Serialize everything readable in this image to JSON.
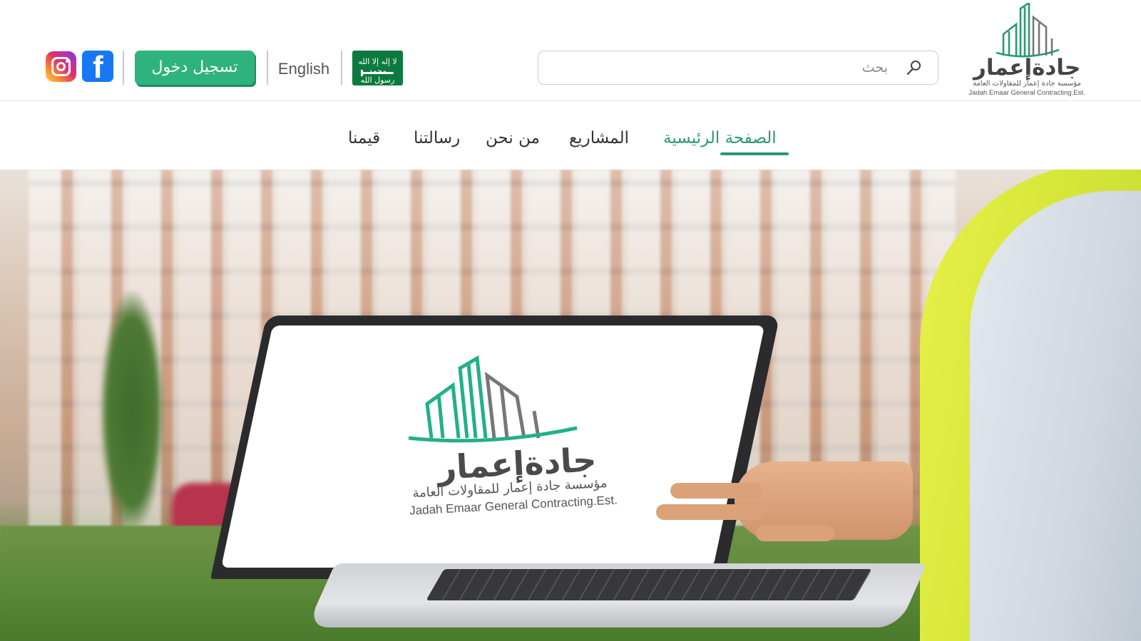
{
  "brand": {
    "name_ar": "جادةإعمار",
    "subtitle_ar": "مؤسسة جادة إعمار للمقاولات العامة",
    "subtitle_en": "Jadah Emaar General Contracting.Est.",
    "accent_color": "#2a9a70",
    "logo_icon": "building-skyline-icon"
  },
  "header": {
    "search": {
      "placeholder": "بحث",
      "value": "",
      "icon": "search-icon"
    },
    "flag": {
      "icon": "saudi-flag-icon",
      "text": "لا إله إلا الله محمد رسول الله"
    },
    "language_label": "English",
    "login_label": "تسجيل دخول",
    "login_color": "#2eb37f",
    "social": [
      {
        "name": "facebook",
        "icon": "facebook-icon",
        "glyph": "f",
        "color": "#1877f2"
      },
      {
        "name": "instagram",
        "icon": "instagram-icon"
      }
    ]
  },
  "nav": {
    "items": [
      {
        "label": "الصفحة الرئيسية",
        "active": true
      },
      {
        "label": "المشاريع",
        "active": false
      },
      {
        "label": "من نحن",
        "active": false
      },
      {
        "label": "رسالتنا",
        "active": false
      },
      {
        "label": "قيمنا",
        "active": false
      }
    ]
  },
  "hero": {
    "description": "",
    "screen_logo": {
      "name_ar": "جادةإعمار",
      "subtitle_ar": "مؤسسة جادة إعمار للمقاولات العامة",
      "subtitle_en": "Jadah Emaar General Contracting.Est."
    }
  }
}
